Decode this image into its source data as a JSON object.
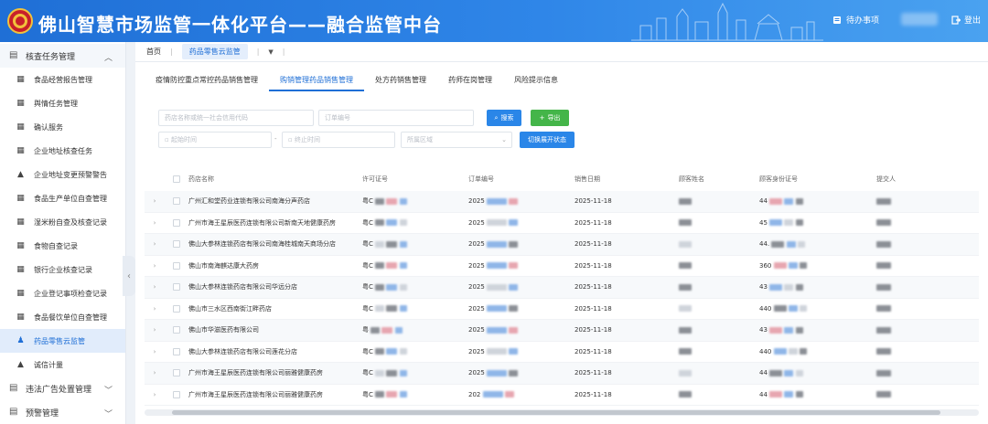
{
  "header": {
    "title": "佛山智慧市场监管一体化平台——融合监管中台",
    "todo_label": "待办事项",
    "logout_label": "登出",
    "todo_icon": "book-icon",
    "logout_icon": "logout-icon"
  },
  "sidebar": {
    "group_top": {
      "label": "核查任务管理",
      "icon": "clipboard-icon"
    },
    "items": [
      {
        "label": "食品经营报告管理",
        "icon": "doc-icon"
      },
      {
        "label": "舆情任务管理",
        "icon": "doc-icon"
      },
      {
        "label": "确认服务",
        "icon": "doc-icon"
      },
      {
        "label": "企业地址核查任务",
        "icon": "doc-icon"
      },
      {
        "label": "企业地址变更预警警告",
        "icon": "warning-icon"
      },
      {
        "label": "食品生产单位自查管理",
        "icon": "doc-icon"
      },
      {
        "label": "湿米粉自查及核查记录",
        "icon": "doc-icon"
      },
      {
        "label": "食物自查记录",
        "icon": "doc-icon"
      },
      {
        "label": "银行企业核查记录",
        "icon": "doc-icon"
      },
      {
        "label": "企业登记事项检查记录",
        "icon": "doc-icon"
      },
      {
        "label": "食品餐饮单位自查管理",
        "icon": "doc-icon"
      },
      {
        "label": "药品零售云监管",
        "icon": "flask-icon",
        "active": true
      },
      {
        "label": "诚信计量",
        "icon": "warning-icon"
      }
    ],
    "group_mid": {
      "label": "违法广告处置管理",
      "icon": "clipboard-icon"
    },
    "group_bottom": {
      "label": "预警管理",
      "icon": "clipboard-icon"
    }
  },
  "breadcrumb": {
    "home": "首页",
    "current": "药品零售云监管"
  },
  "tabs": [
    {
      "label": "疫情防控重点常控药品销售管理"
    },
    {
      "label": "购销管理药品销售管理",
      "active": true
    },
    {
      "label": "处方药销售管理"
    },
    {
      "label": "药师在岗管理"
    },
    {
      "label": "风险提示信息"
    }
  ],
  "filters": {
    "store_placeholder": "药店名称或统一社会信用代码",
    "order_placeholder": "订单编号",
    "start_placeholder": "起始时间",
    "end_placeholder": "终止时间",
    "region_placeholder": "所属区域",
    "range_sep": "-",
    "search_label": "搜索",
    "export_label": "导出",
    "toggle_label": "切换展开状态"
  },
  "table": {
    "headers": [
      "药店名称",
      "许可证号",
      "订单编号",
      "销售日期",
      "顾客姓名",
      "顾客身份证号",
      "提交人"
    ],
    "rows": [
      {
        "store": "广州汇和堂药业连锁有限公司南海分声药店",
        "lic": "粤C",
        "order": "2025",
        "date": "2025-11-18",
        "id": "44"
      },
      {
        "store": "广州市海王星辰医药连锁有限公司新南天地健康药房",
        "lic": "粤C",
        "order": "2025",
        "date": "2025-11-18",
        "id": "45"
      },
      {
        "store": "佛山大参林连锁药店有限公司南海桂城南天商场分店",
        "lic": "粤C",
        "order": "2025",
        "date": "2025-11-18",
        "id": "44."
      },
      {
        "store": "佛山市南海麒达康大药房",
        "lic": "粤C",
        "order": "2025",
        "date": "2025-11-18",
        "id": "360"
      },
      {
        "store": "佛山大参林连锁药店有限公司华远分店",
        "lic": "粤C",
        "order": "2025",
        "date": "2025-11-18",
        "id": "43"
      },
      {
        "store": "佛山市三水区西南街江畔药店",
        "lic": "粤C",
        "order": "2025",
        "date": "2025-11-18",
        "id": "440"
      },
      {
        "store": "佛山市华滋医药有限公司",
        "lic": "粤",
        "order": "2025",
        "date": "2025-11-18",
        "id": "43"
      },
      {
        "store": "佛山大参林连锁药店有限公司莲花分店",
        "lic": "粤C",
        "order": "2025",
        "date": "2025-11-18",
        "id": "440"
      },
      {
        "store": "广州市海王星辰医药连锁有限公司丽雅健康药房",
        "lic": "粤C",
        "order": "2025",
        "date": "2025-11-18",
        "id": "44"
      },
      {
        "store": "广州市海王星辰医药连锁有限公司丽雅健康药房",
        "lic": "粤C",
        "order": "202",
        "date": "2025-11-18",
        "id": "44"
      }
    ]
  },
  "colors": {
    "primary": "#1f6fd6",
    "export_green": "#44b549",
    "header_bg": "#2f86e8"
  }
}
